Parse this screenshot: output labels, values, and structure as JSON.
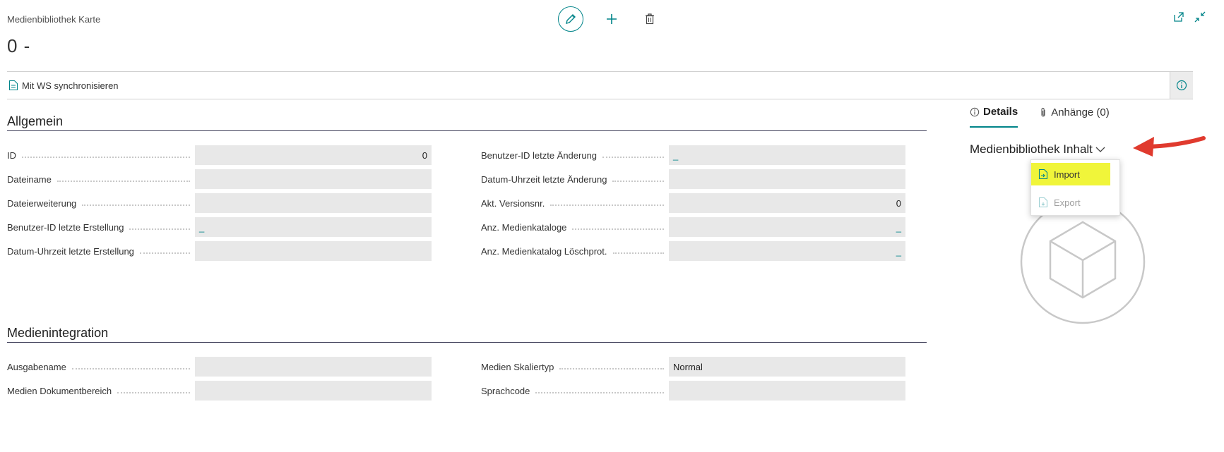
{
  "page": {
    "caption": "Medienbibliothek Karte",
    "record_title": "0 -"
  },
  "toolbar": {
    "edit_icon": "pencil-icon",
    "new_icon": "plus-icon",
    "delete_icon": "trash-icon"
  },
  "window": {
    "open_new_icon": "open-in-new-window-icon",
    "collapse_icon": "collapse-icon"
  },
  "actionbar": {
    "sync_label": "Mit WS synchronisieren",
    "info_icon": "info-icon"
  },
  "general": {
    "title": "Allgemein",
    "left_fields": [
      {
        "label": "ID",
        "value": "0",
        "align": "right"
      },
      {
        "label": "Dateiname",
        "value": ""
      },
      {
        "label": "Dateierweiterung",
        "value": ""
      },
      {
        "label": "Benutzer-ID letzte Erstellung",
        "value": "_",
        "style": "teal"
      },
      {
        "label": "Datum-Uhrzeit letzte Erstellung",
        "value": ""
      }
    ],
    "right_fields": [
      {
        "label": "Benutzer-ID letzte Änderung",
        "value": "_",
        "style": "teal"
      },
      {
        "label": "Datum-Uhrzeit letzte Änderung",
        "value": ""
      },
      {
        "label": "Akt. Versionsnr.",
        "value": "0",
        "align": "right"
      },
      {
        "label": "Anz. Medienkataloge",
        "value": "_",
        "align": "right",
        "style": "teal"
      },
      {
        "label": "Anz. Medienkatalog Löschprot.",
        "value": "_",
        "align": "right",
        "style": "teal"
      }
    ]
  },
  "media_integration": {
    "title": "Medienintegration",
    "left_fields": [
      {
        "label": "Ausgabename",
        "value": ""
      },
      {
        "label": "Medien Dokumentbereich",
        "value": ""
      }
    ],
    "right_fields": [
      {
        "label": "Medien Skaliertyp",
        "value": "Normal"
      },
      {
        "label": "Sprachcode",
        "value": ""
      }
    ]
  },
  "factbox": {
    "tabs": [
      {
        "label": "Details",
        "icon": "info-icon",
        "active": true
      },
      {
        "label": "Anhänge (0)",
        "icon": "paperclip-icon",
        "active": false
      }
    ],
    "heading": "Medienbibliothek Inhalt",
    "menu": [
      {
        "label": "Import",
        "icon": "import-icon",
        "highlighted": true
      },
      {
        "label": "Export",
        "icon": "export-icon",
        "disabled": true
      }
    ],
    "placeholder_icon": "cube-placeholder-icon"
  },
  "colors": {
    "accent": "#008489",
    "highlight": "#f0f53a",
    "arrow": "#e03a2e"
  }
}
